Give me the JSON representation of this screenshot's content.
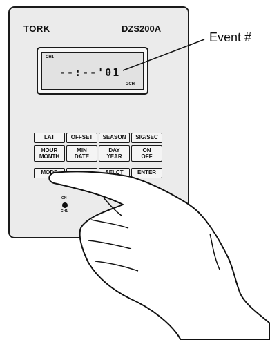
{
  "device": {
    "brand": "TORK",
    "model": "DZS200A"
  },
  "lcd": {
    "channel_label": "CH1",
    "readout": "--:--'01",
    "sub_label": "2CH"
  },
  "callout": {
    "label": "Event #"
  },
  "keys": {
    "row1": [
      "LAT",
      "OFFSET",
      "SEASON",
      "SIG/SEC"
    ],
    "row2": [
      [
        "HOUR",
        "MONTH"
      ],
      [
        "MIN",
        "DATE"
      ],
      [
        "DAY",
        "YEAR"
      ],
      [
        "ON",
        "OFF"
      ]
    ],
    "row3": [
      "MODE",
      "",
      "SELCT",
      "ENTER"
    ]
  },
  "indicator": {
    "on_label": "ON",
    "ch_label": "CH1"
  },
  "icons": {
    "hand": "pointing-hand-icon"
  }
}
